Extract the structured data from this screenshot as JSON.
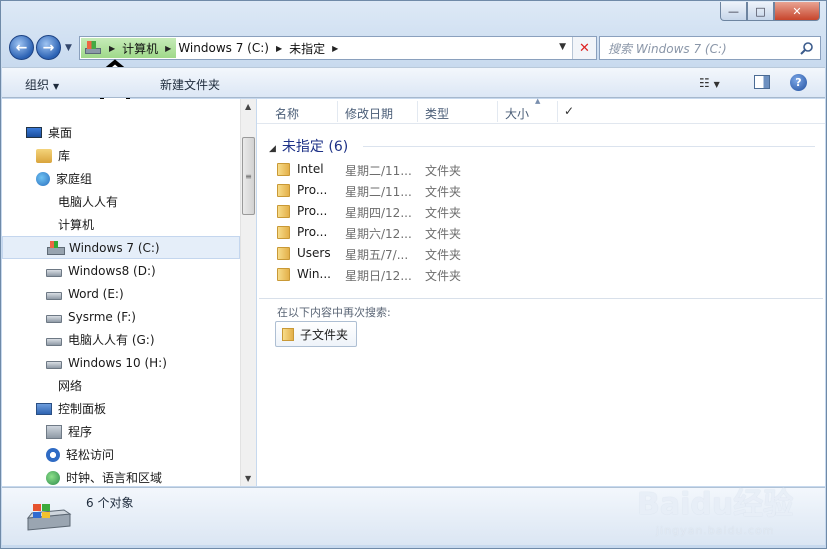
{
  "window": {
    "caption_min": "—",
    "caption_max": "□",
    "caption_close": "✕"
  },
  "nav": {
    "back_icon": "arrow-left",
    "forward_icon": "arrow-right"
  },
  "address": {
    "crumbs": [
      "计算机",
      "Windows 7  (C:)",
      "未指定"
    ],
    "highlight_color": "#a6dc8f"
  },
  "search": {
    "placeholder": "搜索 Windows 7  (C:)"
  },
  "toolbar": {
    "organize": "组织",
    "new_folder": "新建文件夹"
  },
  "sidebar": {
    "items": [
      {
        "label": "桌面",
        "icon": "desktop-icon",
        "level": 0
      },
      {
        "label": "库",
        "icon": "library-icon",
        "level": 1
      },
      {
        "label": "家庭组",
        "icon": "homegroup-icon",
        "level": 1
      },
      {
        "label": "电脑人人有",
        "icon": "user-folder-icon",
        "level": 1
      },
      {
        "label": "计算机",
        "icon": "computer-icon",
        "level": 1
      },
      {
        "label": "Windows 7  (C:)",
        "icon": "windows-drive-icon",
        "level": 2,
        "selected": true
      },
      {
        "label": "Windows8 (D:)",
        "icon": "drive-icon",
        "level": 2
      },
      {
        "label": "Word (E:)",
        "icon": "drive-icon",
        "level": 2
      },
      {
        "label": "Sysrme (F:)",
        "icon": "drive-icon",
        "level": 2
      },
      {
        "label": "电脑人人有 (G:)",
        "icon": "drive-icon",
        "level": 2
      },
      {
        "label": "Windows 10 (H:)",
        "icon": "drive-icon",
        "level": 2
      },
      {
        "label": "网络",
        "icon": "network-icon",
        "level": 1
      },
      {
        "label": "控制面板",
        "icon": "control-panel-icon",
        "level": 1
      },
      {
        "label": "程序",
        "icon": "programs-icon",
        "level": 2
      },
      {
        "label": "轻松访问",
        "icon": "ease-of-access-icon",
        "level": 2
      },
      {
        "label": "时钟、语言和区域",
        "icon": "clock-region-icon",
        "level": 2
      }
    ]
  },
  "columns": {
    "name": "名称",
    "modified": "修改日期",
    "type": "类型",
    "size": "大小"
  },
  "group": {
    "title": "未指定 (6)"
  },
  "files": [
    {
      "name": "Intel",
      "date": "星期二/11...",
      "type": "文件夹"
    },
    {
      "name": "Pro...",
      "date": "星期二/11...",
      "type": "文件夹"
    },
    {
      "name": "Pro...",
      "date": "星期四/12...",
      "type": "文件夹"
    },
    {
      "name": "Pro...",
      "date": "星期六/12...",
      "type": "文件夹"
    },
    {
      "name": "Users",
      "date": "星期五/7/...",
      "type": "文件夹"
    },
    {
      "name": "Win...",
      "date": "星期日/12...",
      "type": "文件夹"
    }
  ],
  "search_again": {
    "label": "在以下内容中再次搜索:",
    "subfolder": "子文件夹"
  },
  "details": {
    "count": "6 个对象"
  },
  "watermark": {
    "text": "Baidu经验",
    "url": "jingyan.baidu.com"
  }
}
